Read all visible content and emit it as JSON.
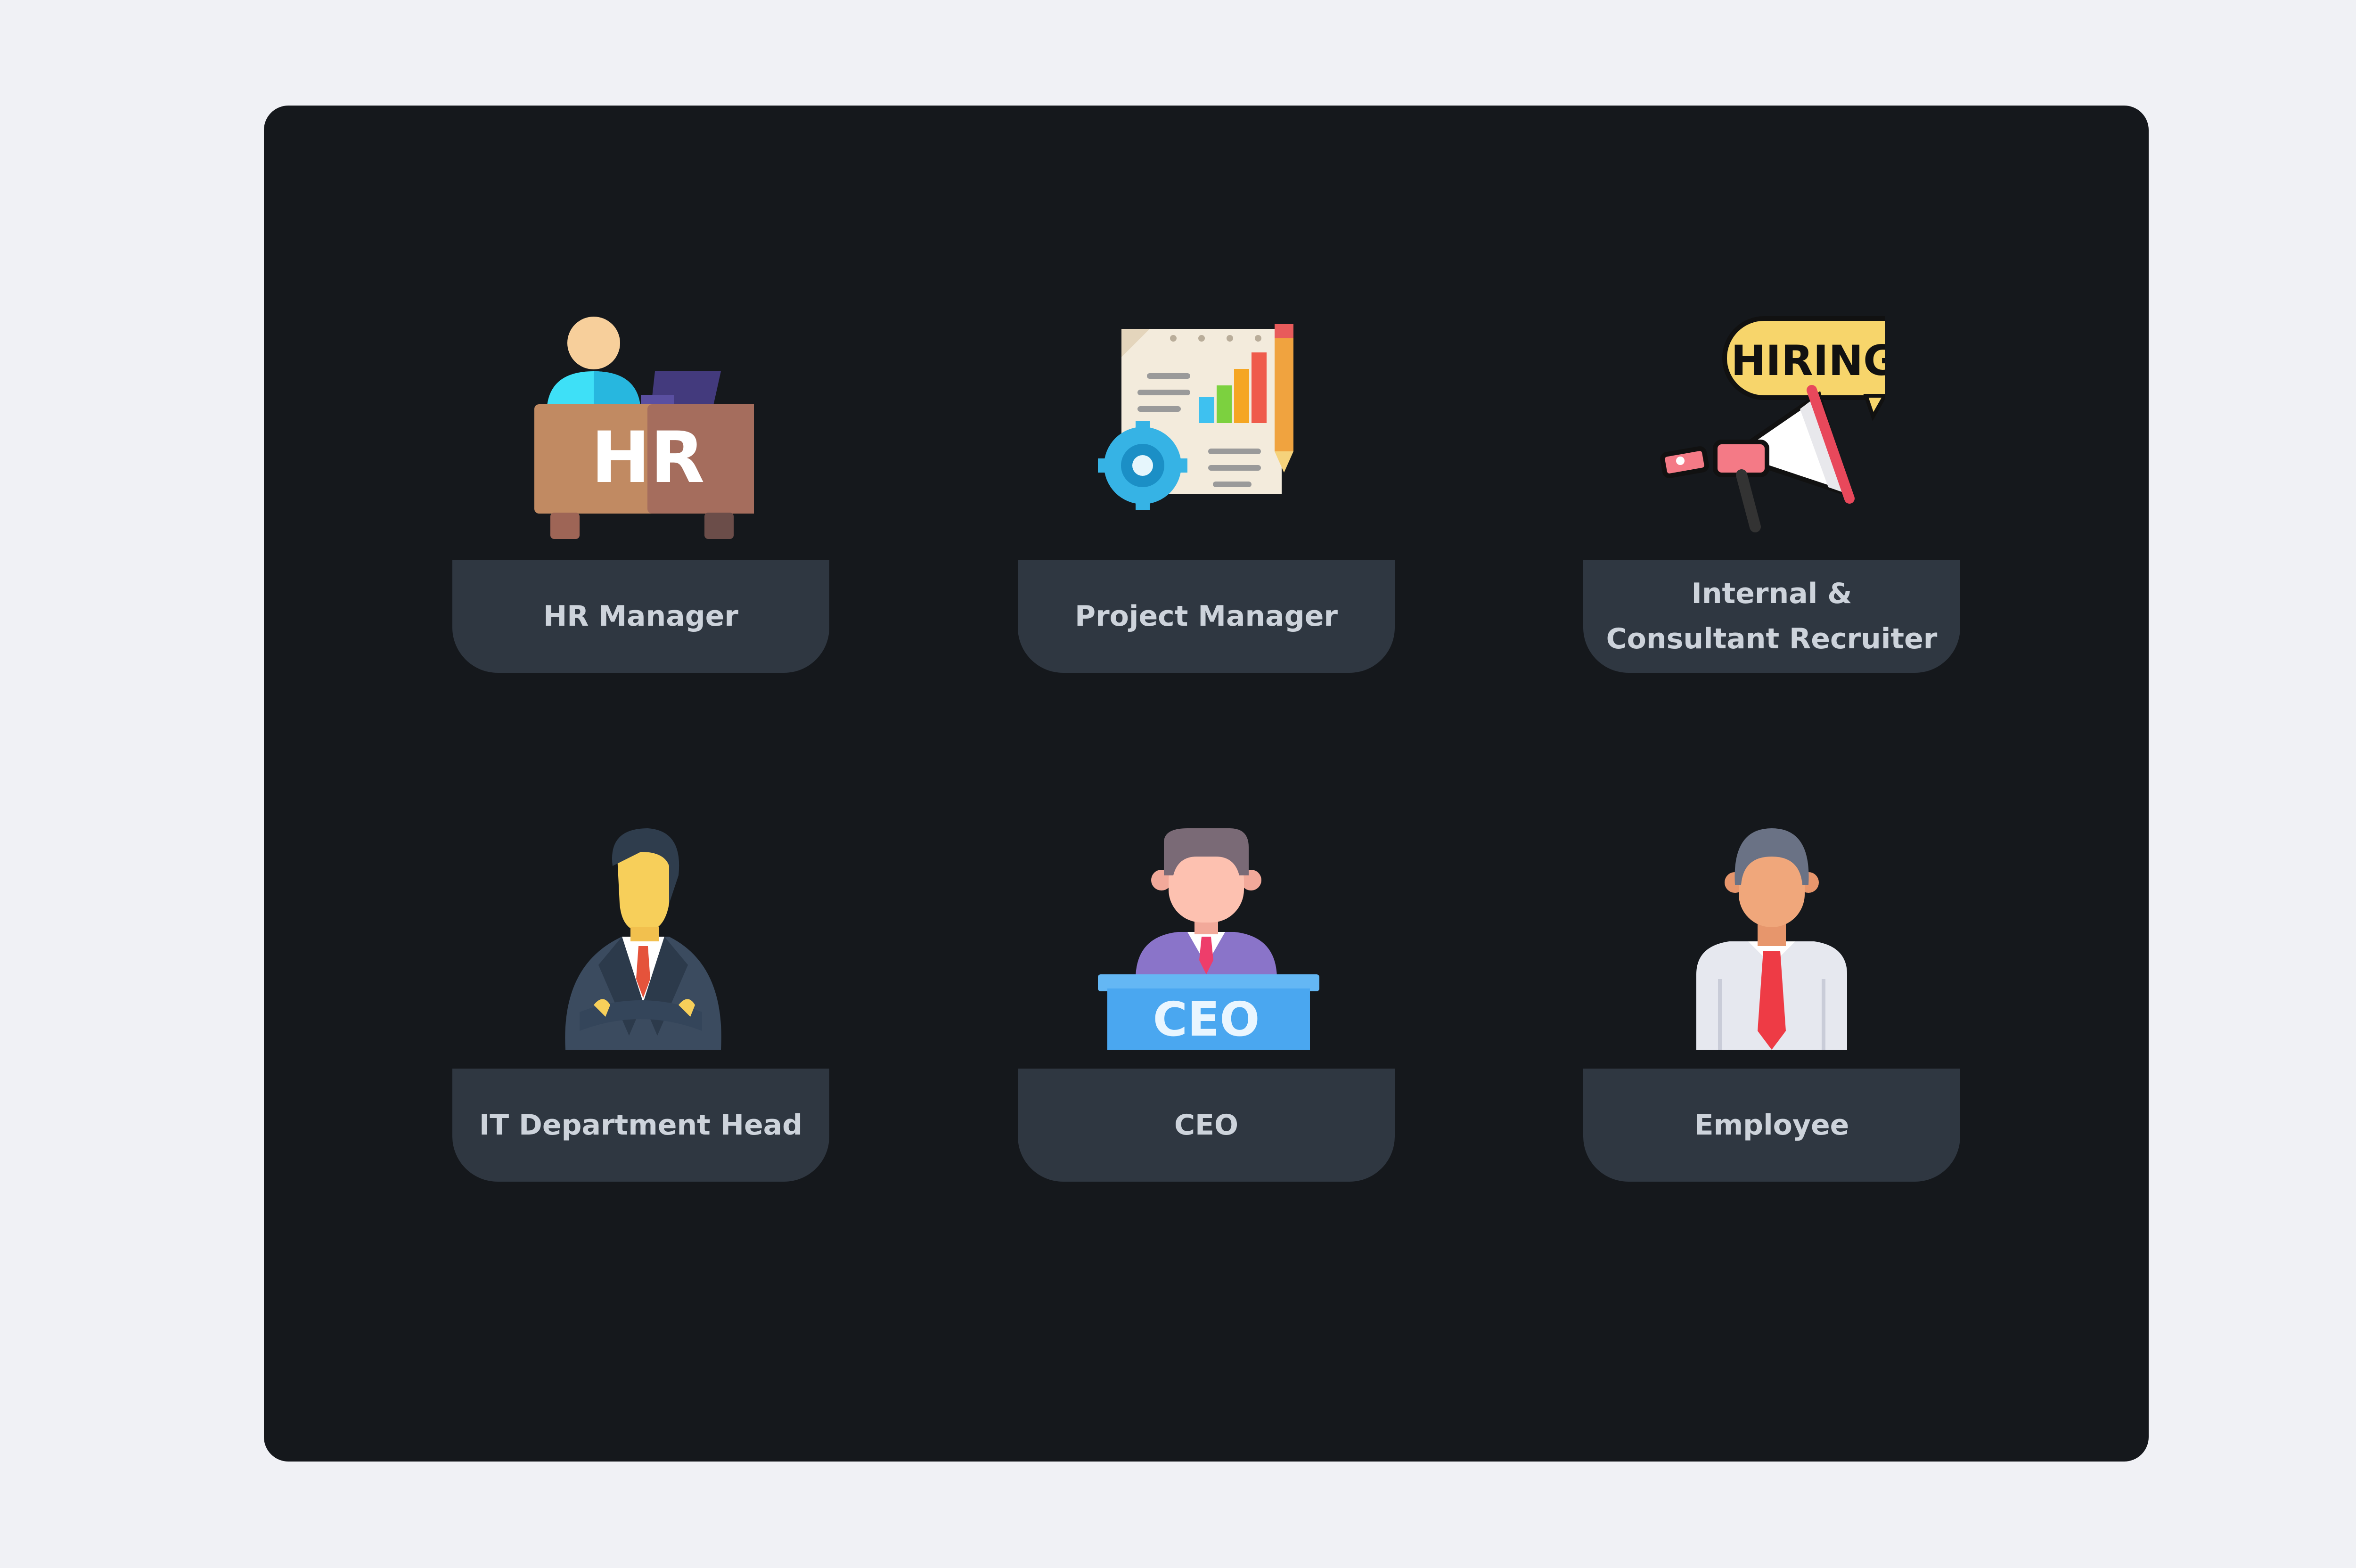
{
  "roles": [
    {
      "label": "HR Manager",
      "icon": "hr-desk-icon",
      "icon_text": "HR"
    },
    {
      "label": "Project Manager",
      "icon": "project-report-icon"
    },
    {
      "label": "Internal & Consultant Recruiter",
      "icon": "hiring-megaphone-icon",
      "icon_text": "HIRING!"
    },
    {
      "label": "IT Department Head",
      "icon": "businessman-icon"
    },
    {
      "label": "CEO",
      "icon": "ceo-podium-icon",
      "icon_text": "CEO"
    },
    {
      "label": "Employee",
      "icon": "employee-icon"
    }
  ]
}
